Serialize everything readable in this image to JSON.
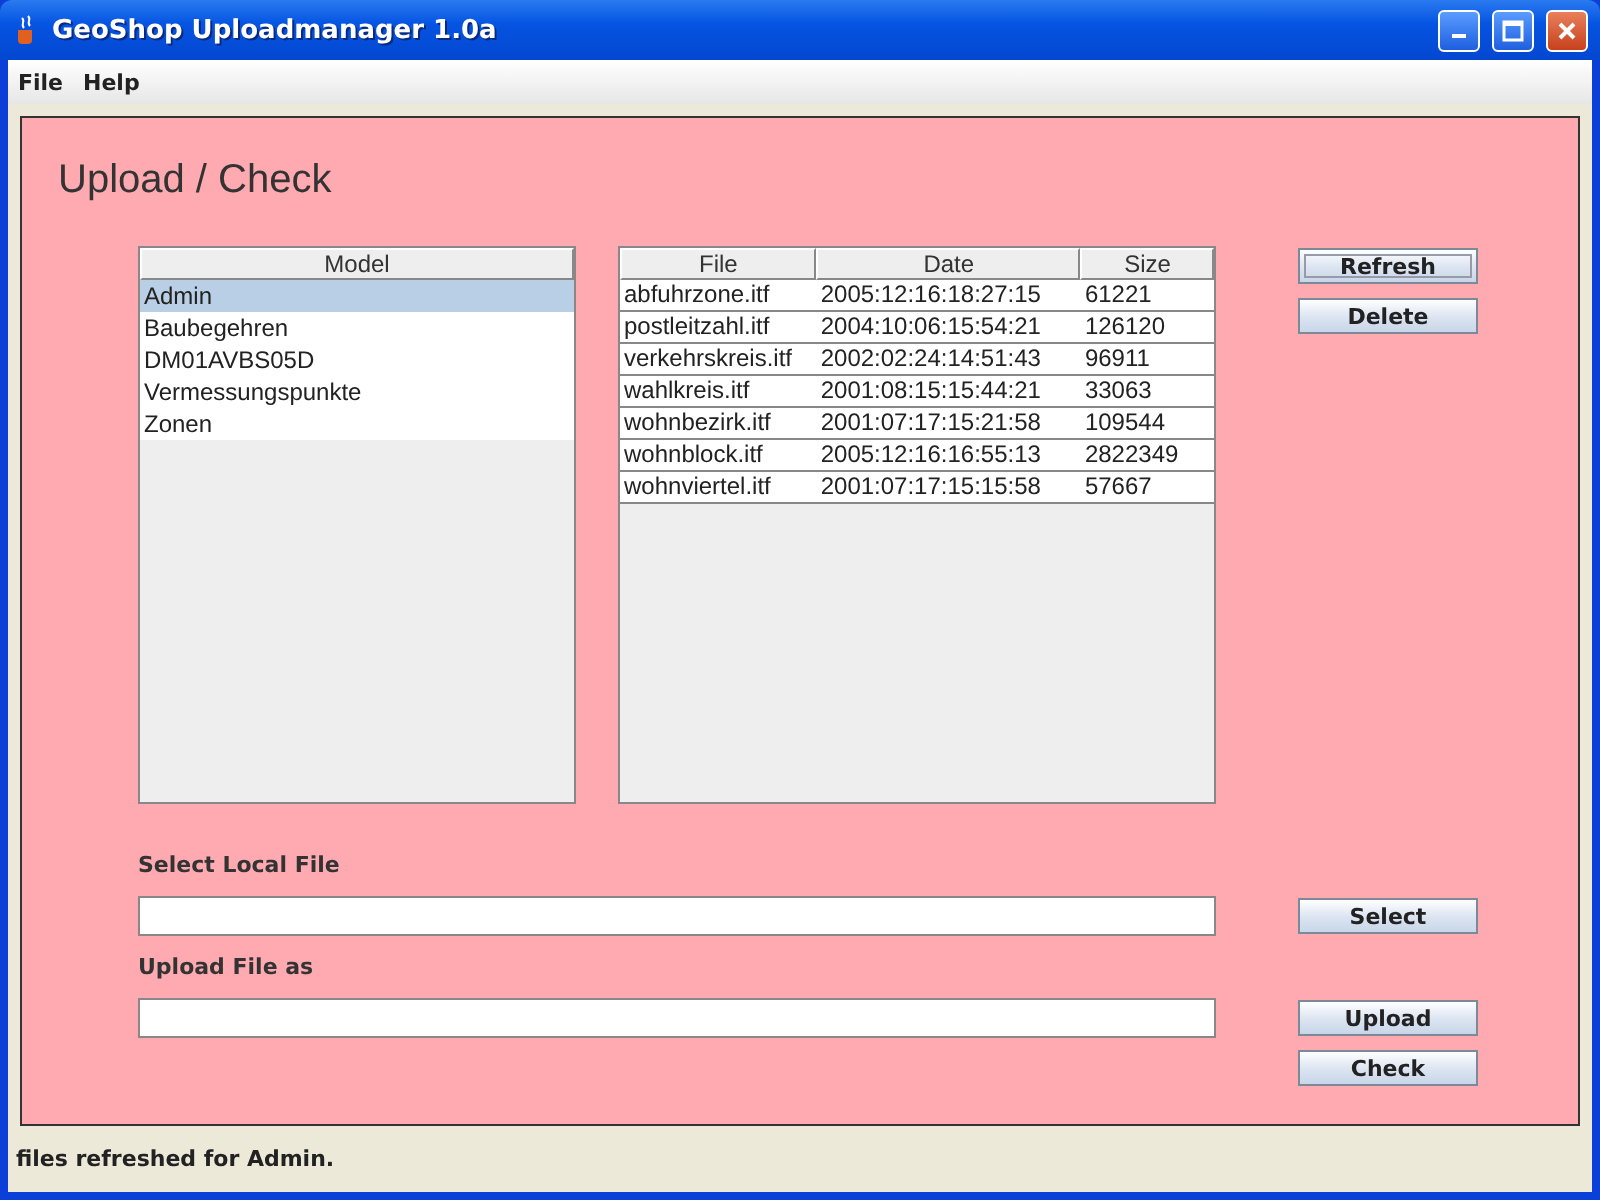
{
  "window": {
    "title": "GeoShop Uploadmanager 1.0a"
  },
  "menu": [
    "File",
    "Help"
  ],
  "heading": "Upload / Check",
  "model_table": {
    "column": "Model",
    "rows": [
      {
        "name": "Admin",
        "selected": true
      },
      {
        "name": "Baubegehren",
        "selected": false
      },
      {
        "name": "DM01AVBS05D",
        "selected": false
      },
      {
        "name": "Vermessungspunkte",
        "selected": false
      },
      {
        "name": "Zonen",
        "selected": false
      }
    ]
  },
  "file_table": {
    "columns": [
      "File",
      "Date",
      "Size"
    ],
    "rows": [
      [
        "abfuhrzone.itf",
        "2005:12:16:18:27:15",
        "61221"
      ],
      [
        "postleitzahl.itf",
        "2004:10:06:15:54:21",
        "126120"
      ],
      [
        "verkehrskreis.itf",
        "2002:02:24:14:51:43",
        "96911"
      ],
      [
        "wahlkreis.itf",
        "2001:08:15:15:44:21",
        "33063"
      ],
      [
        "wohnbezirk.itf",
        "2001:07:17:15:21:58",
        "109544"
      ],
      [
        "wohnblock.itf",
        "2005:12:16:16:55:13",
        "2822349"
      ],
      [
        "wohnviertel.itf",
        "2001:07:17:15:15:58",
        "57667"
      ]
    ]
  },
  "side_buttons": [
    {
      "label": "Refresh",
      "focused": true
    },
    {
      "label": "Delete",
      "focused": false
    }
  ],
  "local_file": {
    "label": "Select Local File",
    "button": "Select"
  },
  "upload_as": {
    "label": "Upload File as",
    "buttons": [
      "Upload",
      "Check"
    ]
  },
  "status_bar": "files refreshed for Admin."
}
